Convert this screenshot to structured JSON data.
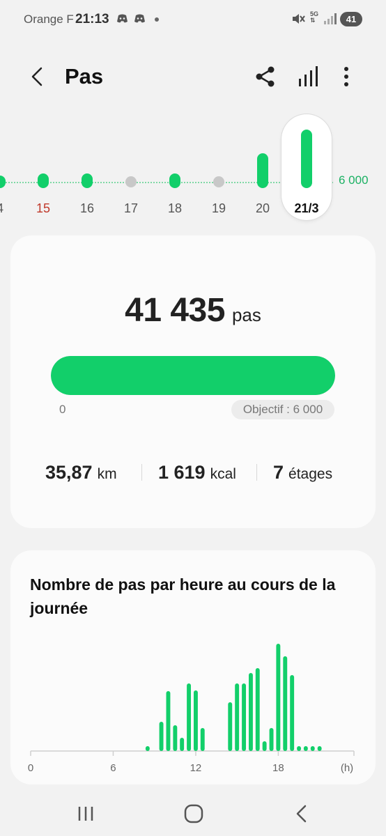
{
  "status_bar": {
    "carrier": "Orange F",
    "time": "21:13",
    "network": "5G",
    "battery": "41"
  },
  "header": {
    "title": "Pas"
  },
  "day_strip": {
    "goal_label": "6 000",
    "days": [
      {
        "label": "4",
        "steps_ratio": 0.1,
        "met": true,
        "sunday": false
      },
      {
        "label": "15",
        "steps_ratio": 0.25,
        "met": true,
        "sunday": true
      },
      {
        "label": "16",
        "steps_ratio": 0.25,
        "met": true,
        "sunday": false
      },
      {
        "label": "17",
        "steps_ratio": 0.0,
        "met": false,
        "sunday": false
      },
      {
        "label": "18",
        "steps_ratio": 0.25,
        "met": true,
        "sunday": false
      },
      {
        "label": "19",
        "steps_ratio": 0.0,
        "met": false,
        "sunday": false
      },
      {
        "label": "20",
        "steps_ratio": 0.6,
        "met": true,
        "sunday": false
      },
      {
        "label": "21/3",
        "steps_ratio": 1.0,
        "met": true,
        "sunday": false,
        "selected": true
      }
    ]
  },
  "summary": {
    "steps": "41 435",
    "steps_unit": "pas",
    "progress_percent": 100,
    "progress_min": "0",
    "goal_label": "Objectif : 6 000",
    "distance_value": "35,87",
    "distance_unit": "km",
    "calories_value": "1 619",
    "calories_unit": "kcal",
    "floors_value": "7",
    "floors_unit": "étages"
  },
  "hourly": {
    "title": "Nombre de pas par heure au cours de la journée"
  },
  "colors": {
    "accent": "#12cf6a",
    "goal_text": "#1bb163",
    "sunday": "#c0392b",
    "inactive": "#c8c8c8"
  },
  "chart_data": {
    "type": "bar",
    "xlabel": "(h)",
    "x_ticks": [
      "0",
      "6",
      "12",
      "18"
    ],
    "x_range": [
      0,
      23.5
    ],
    "bar_width_hours": 0.3,
    "points": [
      {
        "x": 8.5,
        "y": 7
      },
      {
        "x": 9.5,
        "y": 42
      },
      {
        "x": 10.0,
        "y": 86
      },
      {
        "x": 10.5,
        "y": 37
      },
      {
        "x": 11.0,
        "y": 19
      },
      {
        "x": 11.5,
        "y": 97
      },
      {
        "x": 12.0,
        "y": 87
      },
      {
        "x": 12.5,
        "y": 33
      },
      {
        "x": 14.5,
        "y": 70
      },
      {
        "x": 15.0,
        "y": 97
      },
      {
        "x": 15.5,
        "y": 97
      },
      {
        "x": 16.0,
        "y": 112
      },
      {
        "x": 16.5,
        "y": 119
      },
      {
        "x": 17.0,
        "y": 14
      },
      {
        "x": 17.5,
        "y": 33
      },
      {
        "x": 18.0,
        "y": 154
      },
      {
        "x": 18.5,
        "y": 136
      },
      {
        "x": 19.0,
        "y": 109
      },
      {
        "x": 19.5,
        "y": 7
      },
      {
        "x": 20.0,
        "y": 7
      },
      {
        "x": 20.5,
        "y": 7
      },
      {
        "x": 21.0,
        "y": 7
      }
    ],
    "ylim": [
      0,
      160
    ],
    "grid": false,
    "legend": "none"
  }
}
